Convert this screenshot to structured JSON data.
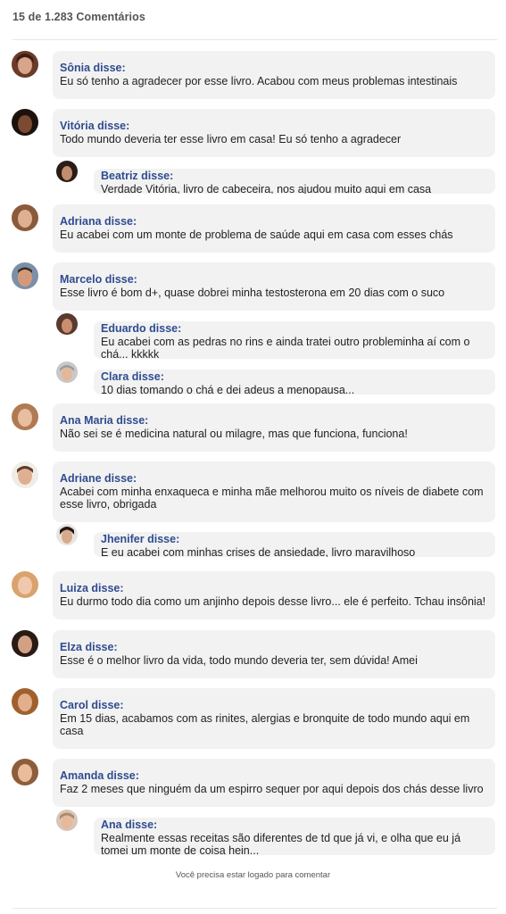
{
  "header": {
    "count_label": "15 de 1.283 Comentários"
  },
  "comments": [
    {
      "author": "Sônia disse:",
      "text": "Eu só tenho a agradecer por esse livro. Acabou com meus problemas intestinais"
    },
    {
      "author": "Vitória disse:",
      "text": "Todo mundo deveria ter esse livro em casa! Eu só tenho a agradecer"
    },
    {
      "author": "Beatriz disse:",
      "text": "Verdade Vitória, livro de cabeceira, nos ajudou muito aqui em casa"
    },
    {
      "author": "Adriana disse:",
      "text": "Eu acabei com um monte de problema de saúde aqui em casa com esses chás"
    },
    {
      "author": "Marcelo disse:",
      "text": "Esse livro é bom d+, quase dobrei minha testosterona em 20 dias com o suco"
    },
    {
      "author": "Eduardo disse:",
      "text": "Eu acabei com as pedras no rins e ainda tratei outro probleminha aí com o chá... kkkkk"
    },
    {
      "author": "Clara disse:",
      "text": "10 dias tomando o chá e dei adeus a menopausa..."
    },
    {
      "author": "Ana Maria disse:",
      "text": "Não sei se é medicina natural ou milagre, mas que funciona, funciona!"
    },
    {
      "author": "Adriane disse:",
      "text": "Acabei com minha enxaqueca e minha mãe melhorou muito os níveis de diabete com esse livro, obrigada"
    },
    {
      "author": "Jhenifer disse:",
      "text": "E eu acabei com minhas crises de ansiedade, livro maravilhoso"
    },
    {
      "author": "Luiza disse:",
      "text": "Eu durmo todo dia como um anjinho depois desse livro... ele é perfeito. Tchau insônia!"
    },
    {
      "author": "Elza disse:",
      "text": "Esse é o melhor livro da vida, todo mundo deveria ter, sem dúvida! Amei"
    },
    {
      "author": "Carol disse:",
      "text": "Em 15 dias, acabamos com as rinites, alergias e bronquite de todo mundo aqui em casa"
    },
    {
      "author": "Amanda disse:",
      "text": "Faz 2 meses que ninguém da um espirro sequer por aqui depois dos chás desse livro"
    },
    {
      "author": "Ana disse:",
      "text": "Realmente essas receitas são diferentes de td que já vi, e olha que eu já tomei um monte de coisa hein..."
    }
  ],
  "footer": {
    "login_notice": "Você precisa estar logado para comentar"
  },
  "colors": {
    "author_name": "#2f4c8f",
    "bubble_bg": "#f2f2f2"
  }
}
